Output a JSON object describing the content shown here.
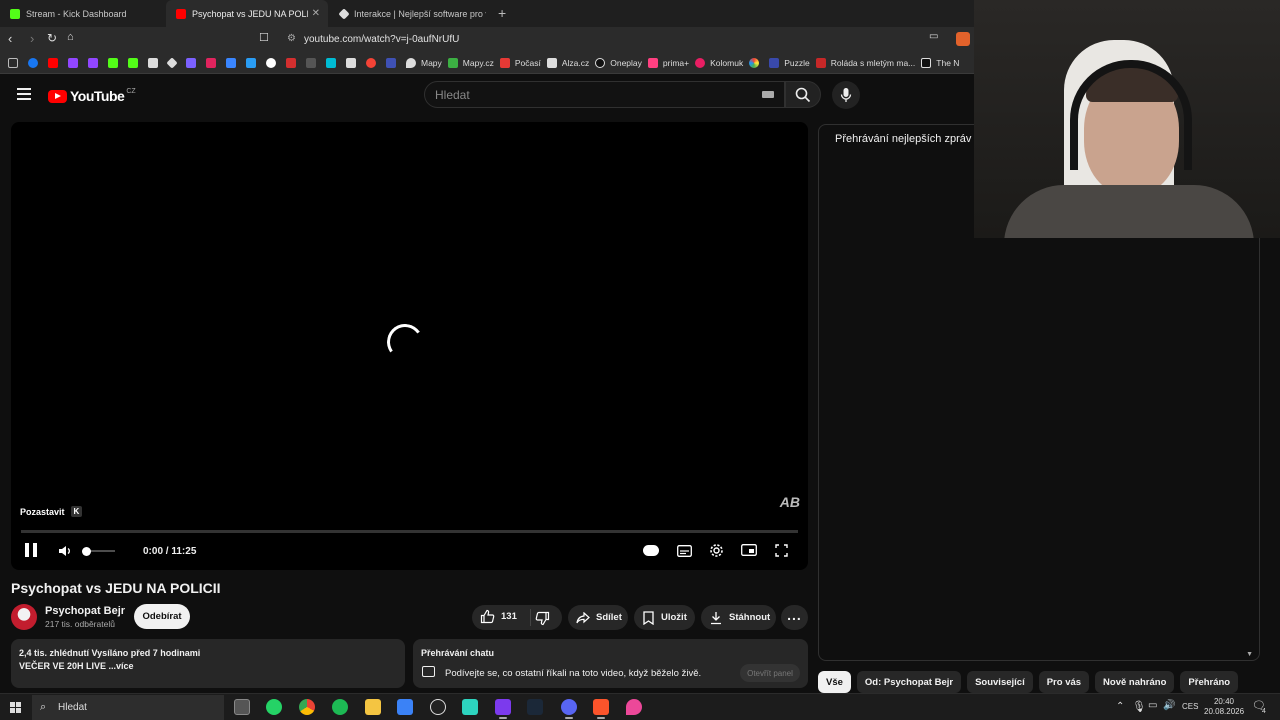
{
  "browser": {
    "tabs": [
      {
        "title": "Stream - Kick Dashboard",
        "favicon_color": "#53fc18"
      },
      {
        "title": "Psychopat vs JEDU NA POLICII -",
        "favicon_color": "#ff0000"
      },
      {
        "title": "Interakce | Nejlepší software pro vyle",
        "favicon_color": "#dddddd"
      }
    ],
    "url": "youtube.com/watch?v=j-0aufNrUfU",
    "bookmarks": [
      "Mapy",
      "Mapy.cz",
      "Počasí",
      "Alza.cz",
      "Oneplay",
      "prima+",
      "Kolomuk",
      "Puzzle",
      "Roláda s mletým ma...",
      "The N"
    ]
  },
  "youtube": {
    "logo": "YouTube",
    "country": "CZ",
    "search_placeholder": "Hledat"
  },
  "player": {
    "pause_tooltip": "Pozastavit",
    "pause_key": "K",
    "time": "0:00 / 11:25",
    "watermark": "AB"
  },
  "video": {
    "title": "Psychopat vs JEDU NA POLICII",
    "channel": "Psychopat Bejr",
    "subscribers": "217 tis. odběratelů",
    "subscribe_label": "Odebírat",
    "likes": "131",
    "share_label": "Sdílet",
    "save_label": "Uložit",
    "download_label": "Stáhnout",
    "description_meta": "2,4 tis. zhlédnutí  Vysíláno před 7 hodinami",
    "description_text": "VEČER VE 20H LIVE ...více",
    "chat_replay_title": "Přehrávání chatu",
    "chat_replay_text": "Podívejte se, co ostatní říkali na toto video, když běželo živě.",
    "open_panel_label": "Otevřít panel"
  },
  "side_panel": {
    "title": "Přehrávání nejlepších zpráv",
    "chips": [
      "Vše",
      "Od: Psychopat Bejr",
      "Související",
      "Pro vás",
      "Nově nahráno",
      "Přehráno"
    ]
  },
  "taskbar": {
    "search_label": "Hledat",
    "language": "CES",
    "time": "20:40",
    "date": "20.08.2026",
    "notifications": "4"
  }
}
